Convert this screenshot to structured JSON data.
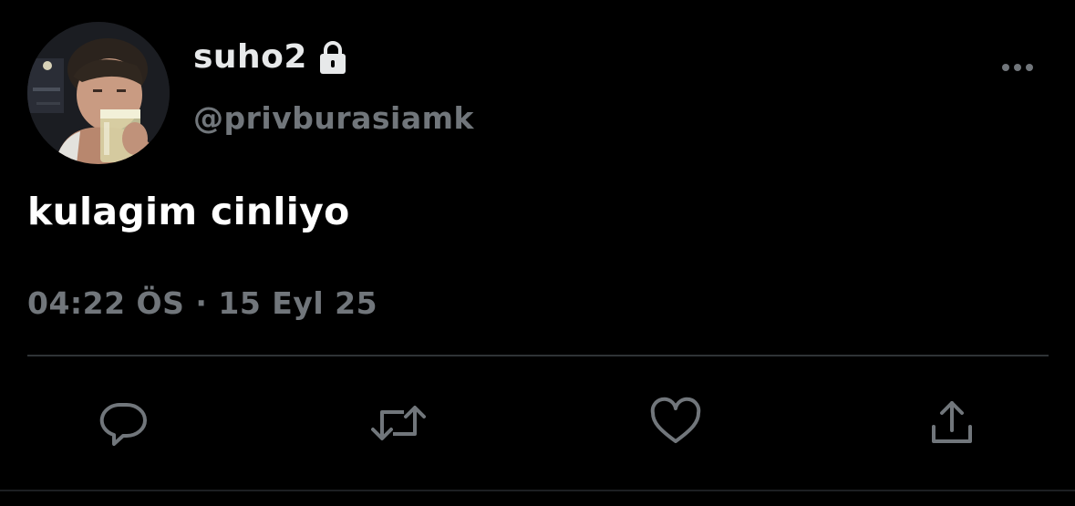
{
  "user": {
    "display_name": "suho2",
    "handle": "@privburasiamk",
    "protected": true
  },
  "tweet": {
    "text": "kulagim cinliyo",
    "timestamp": "04:22 ÖS · 15 Eyl 25"
  },
  "icons": {
    "lock": "lock-icon",
    "more": "more-horizontal-icon",
    "reply": "reply-bubble-icon",
    "retweet": "retweet-icon",
    "like": "heart-icon",
    "share": "share-upload-icon"
  },
  "colors": {
    "background": "#000000",
    "primary_text": "#e7e9ea",
    "secondary_text": "#71767b",
    "divider": "#2f3336",
    "icon": "#71767b"
  }
}
